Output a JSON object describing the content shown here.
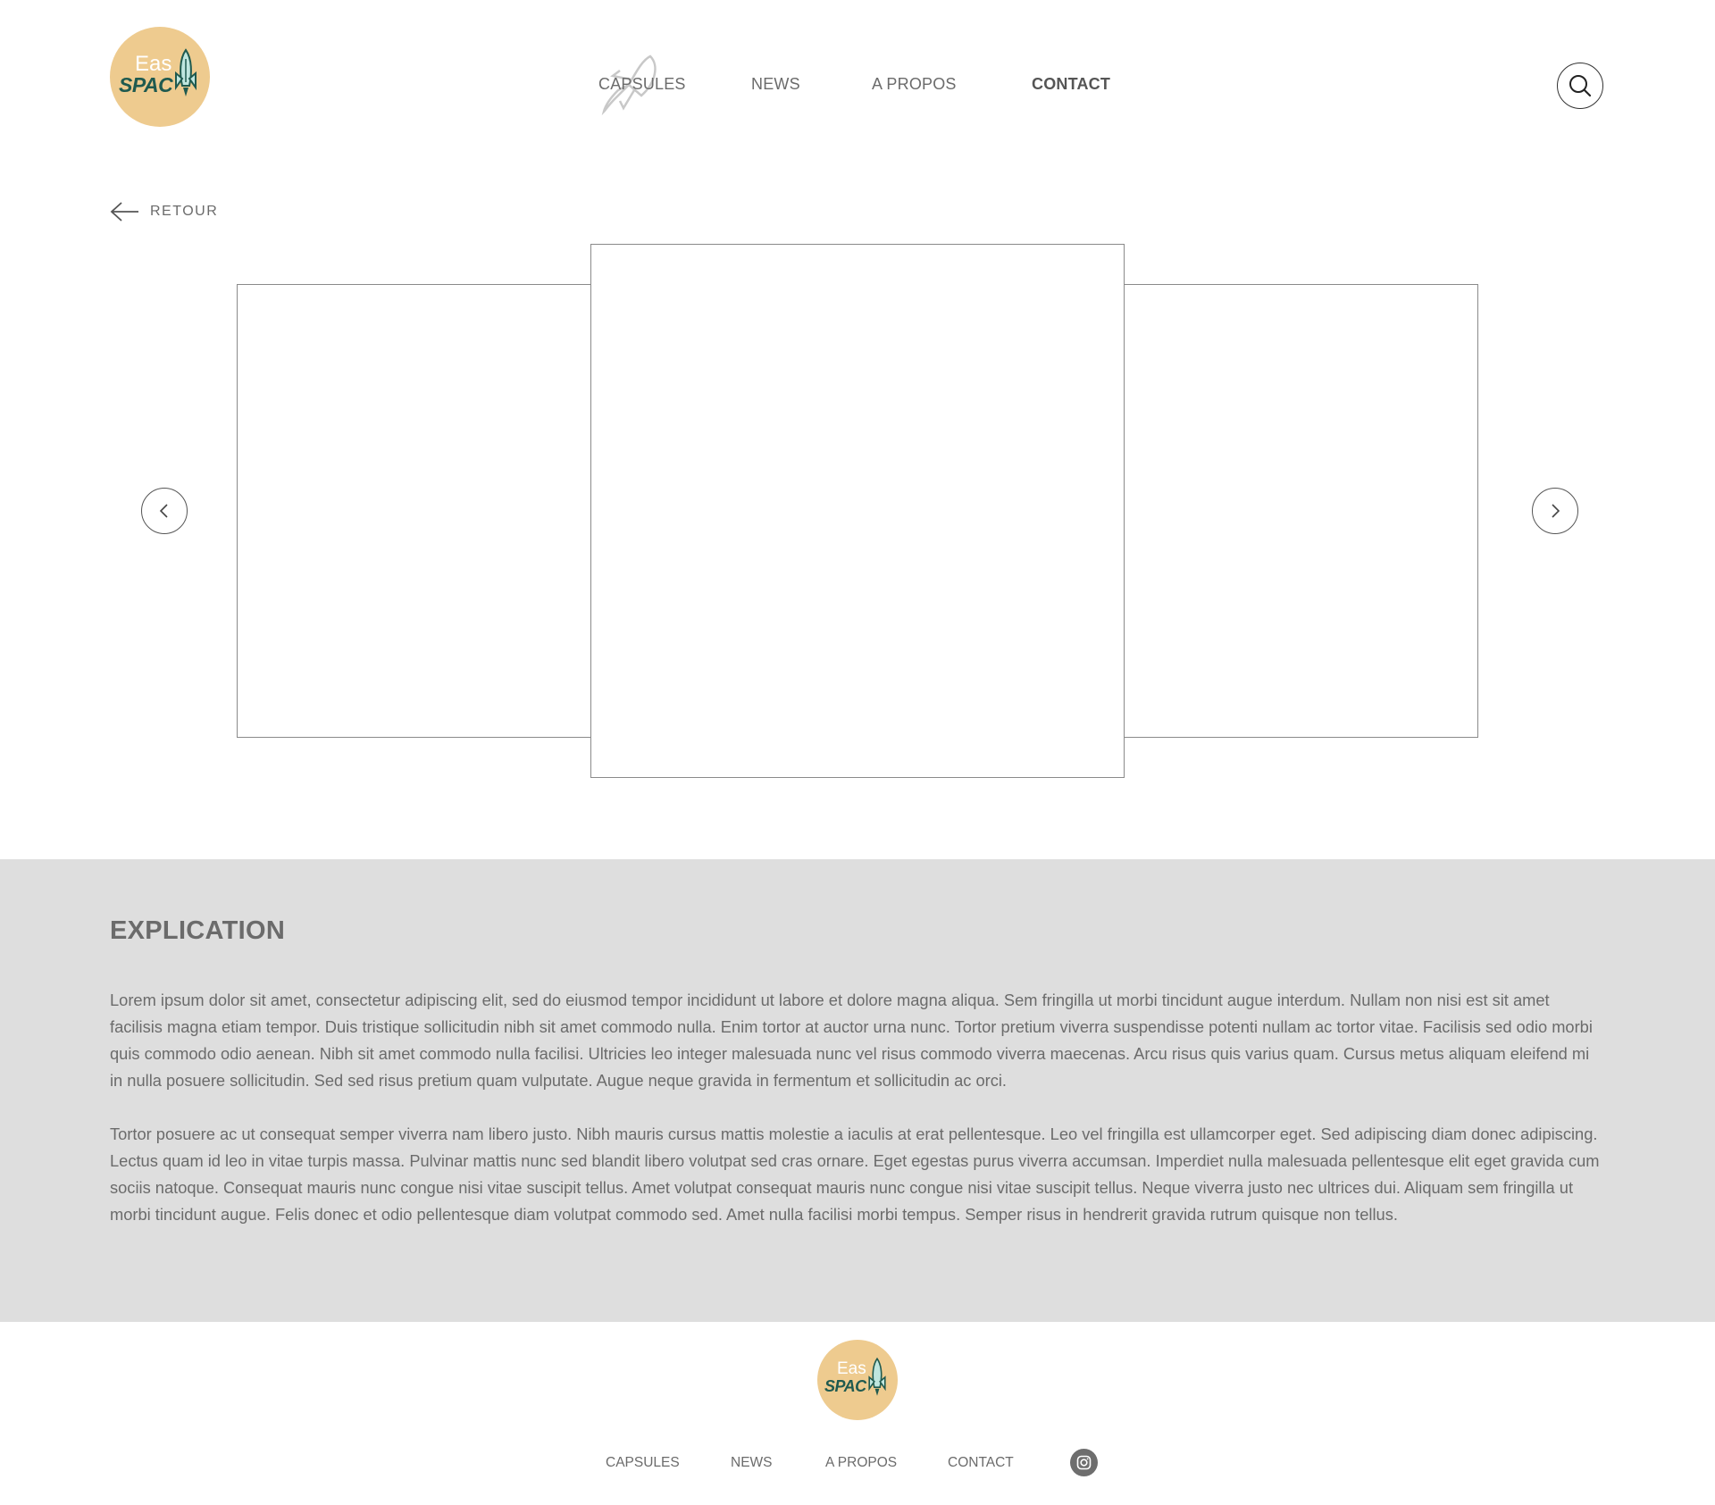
{
  "brand": {
    "logo_line1": "Eas",
    "logo_line2": "SPAC",
    "logo_bg": "#eecb8f",
    "logo_text_color": "#1f5a4f"
  },
  "nav": {
    "items": [
      {
        "label": "CAPSULES"
      },
      {
        "label": "NEWS"
      },
      {
        "label": "A PROPOS"
      },
      {
        "label": "CONTACT",
        "active": true
      }
    ],
    "search_icon": "search-icon"
  },
  "back": {
    "label": "RETOUR",
    "icon": "arrow-left-icon"
  },
  "carousel": {
    "prev_icon": "chevron-left-icon",
    "next_icon": "chevron-right-icon"
  },
  "explication": {
    "title": "EXPLICATION",
    "paragraphs": [
      "Lorem ipsum dolor sit amet, consectetur adipiscing elit, sed do eiusmod tempor incididunt ut labore et dolore magna aliqua. Sem fringilla ut morbi tincidunt augue interdum. Nullam non nisi est sit amet facilisis magna etiam tempor. Duis tristique sollicitudin nibh sit amet commodo nulla. Enim tortor at auctor urna nunc. Tortor pretium viverra suspendisse potenti nullam ac tortor vitae. Facilisis sed odio morbi quis commodo odio aenean. Nibh sit amet commodo nulla facilisi. Ultricies leo integer malesuada nunc vel risus commodo viverra maecenas. Arcu risus quis varius quam. Cursus metus aliquam eleifend mi in nulla posuere sollicitudin. Sed sed risus pretium quam vulputate. Augue neque gravida in fermentum et sollicitudin ac orci.",
      "Tortor posuere ac ut consequat semper viverra nam libero justo. Nibh mauris cursus mattis molestie a iaculis at erat pellentesque. Leo vel fringilla est ullamcorper eget. Sed adipiscing diam donec adipiscing. Lectus quam id leo in vitae turpis massa. Pulvinar mattis nunc sed blandit libero volutpat sed cras ornare. Eget egestas purus viverra accumsan. Imperdiet nulla malesuada pellentesque elit eget gravida cum sociis natoque. Consequat mauris nunc congue nisi vitae suscipit tellus. Amet volutpat consequat mauris nunc congue nisi vitae suscipit tellus. Neque viverra justo nec ultrices dui. Aliquam sem fringilla ut morbi tincidunt augue. Felis donec et odio pellentesque diam volutpat commodo sed. Amet nulla facilisi morbi tempus. Semper risus in hendrerit gravida rutrum quisque non tellus."
    ],
    "bg": "#dedede"
  },
  "footer": {
    "items": [
      {
        "label": "CAPSULES"
      },
      {
        "label": "NEWS"
      },
      {
        "label": "A PROPOS"
      },
      {
        "label": "CONTACT"
      }
    ],
    "social_icon": "instagram-icon"
  }
}
